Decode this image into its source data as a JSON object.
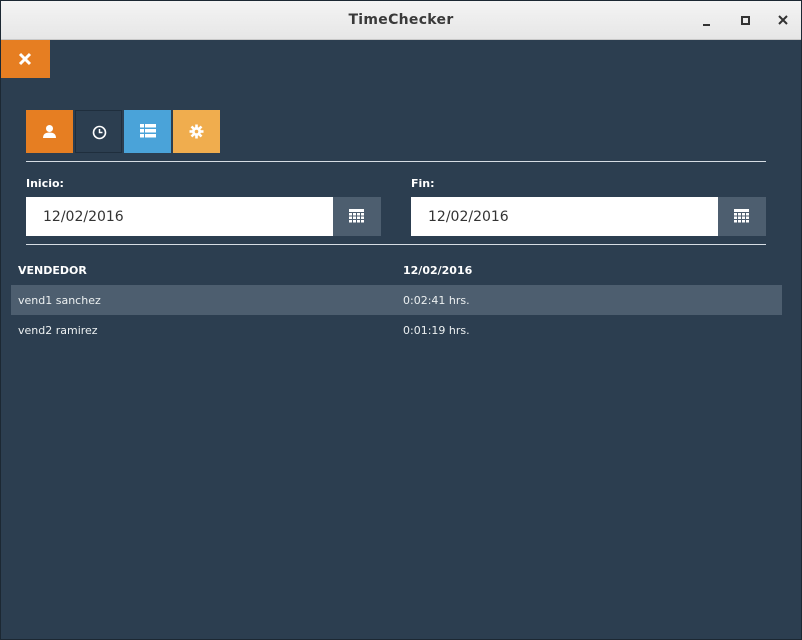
{
  "window": {
    "title": "TimeChecker"
  },
  "toolbar": {
    "buttons": [
      {
        "icon": "user-icon",
        "color": "#e67e22"
      },
      {
        "icon": "clock-icon",
        "color": "#2c3e50"
      },
      {
        "icon": "list-icon",
        "color": "#4aa3d9"
      },
      {
        "icon": "gear-icon",
        "color": "#f0ad4e"
      }
    ]
  },
  "filters": {
    "start_label": "Inicio:",
    "start_value": "12/02/2016",
    "end_label": "Fin:",
    "end_value": "12/02/2016"
  },
  "table": {
    "headers": [
      "VENDEDOR",
      "12/02/2016"
    ],
    "rows": [
      {
        "vendor": "vend1 sanchez",
        "time": "0:02:41 hrs.",
        "selected": true
      },
      {
        "vendor": "vend2 ramirez",
        "time": "0:01:19 hrs.",
        "selected": false
      }
    ]
  },
  "colors": {
    "background": "#2c3e50",
    "accent": "#e67e22",
    "selected_row": "#4d5e6f"
  }
}
